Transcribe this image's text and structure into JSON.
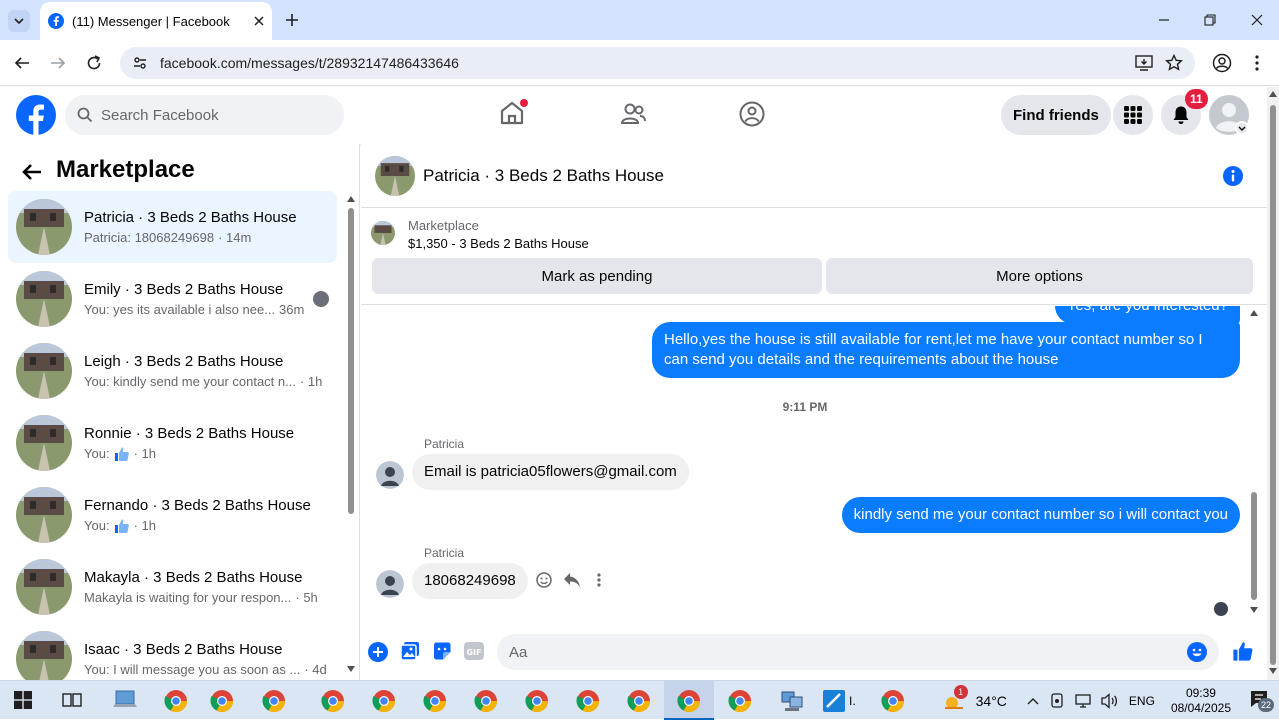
{
  "browser": {
    "tab_title": "(11) Messenger | Facebook",
    "url": "facebook.com/messages/t/28932147486433646"
  },
  "header": {
    "search_placeholder": "Search Facebook",
    "find_friends": "Find friends",
    "notification_count": "11"
  },
  "sidebar": {
    "title": "Marketplace",
    "conversations": [
      {
        "name": "Patricia · 3 Beds 2 Baths House",
        "preview": "Patricia: 18068249698",
        "time": "· 14m"
      },
      {
        "name": "Emily · 3 Beds 2 Baths House",
        "preview": "You: yes its available i also nee...",
        "time": "36m"
      },
      {
        "name": "Leigh · 3 Beds 2 Baths House",
        "preview": "You: kindly send me your contact n...",
        "time": "· 1h"
      },
      {
        "name": "Ronnie · 3 Beds 2 Baths House",
        "preview": "You:",
        "time": "· 1h"
      },
      {
        "name": "Fernando · 3 Beds 2 Baths House",
        "preview": "You:",
        "time": "· 1h"
      },
      {
        "name": "Makayla · 3 Beds 2 Baths House",
        "preview": "Makayla is waiting for your respon...",
        "time": "· 5h"
      },
      {
        "name": "Isaac · 3 Beds 2 Baths House",
        "preview": "You: I will message you as soon as ...",
        "time": "· 4d"
      }
    ]
  },
  "chat": {
    "title": "Patricia · 3 Beds 2 Baths House",
    "listing_source": "Marketplace",
    "listing_title": "$1,350 - 3 Beds 2 Baths House",
    "mark_pending": "Mark as pending",
    "more_options": "More options",
    "partial_message": "Yes, are you interested?",
    "msg_out_1": "Hello,yes the house is still available for rent,let me have your contact number   so I can send you details and the requirements about the house",
    "timestamp": "9:11 PM",
    "sender_1": "Patricia",
    "msg_in_1": "Email is patricia05flowers@gmail.com",
    "msg_out_2": "kindly send me your contact number so i will contact you",
    "sender_2": "Patricia",
    "msg_in_2": "18068249698",
    "composer_placeholder": "Aa"
  },
  "taskbar": {
    "temperature": "34°C",
    "language": "ENG",
    "time": "09:39",
    "date": "08/04/2025",
    "weather_badge": "1",
    "notif_count": "22"
  },
  "colors": {
    "fb_blue": "#0866ff",
    "bubble_out": "#0a7cff",
    "notif_red": "#e41e3f"
  }
}
